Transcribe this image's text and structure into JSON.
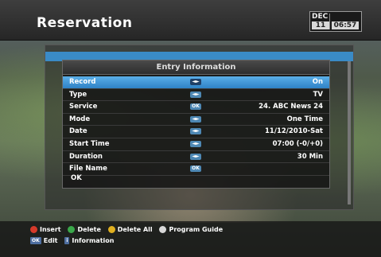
{
  "header": {
    "title": "Reservation",
    "clock": {
      "month": "DEC",
      "day": "11",
      "time": "06:57"
    }
  },
  "dialog": {
    "title": "Entry Information",
    "rows": [
      {
        "label": "Record",
        "icon": "arrows-icon",
        "value": "On",
        "selected": true
      },
      {
        "label": "Type",
        "icon": "arrows-icon",
        "value": "TV"
      },
      {
        "label": "Service",
        "icon": "ok-icon",
        "value": "24. ABC News 24"
      },
      {
        "label": "Mode",
        "icon": "arrows-icon",
        "value": "One Time"
      },
      {
        "label": "Date",
        "icon": "arrows-icon",
        "value": "11/12/2010-Sat"
      },
      {
        "label": "Start Time",
        "icon": "arrows-icon",
        "value": "07:00 (-0/+0)"
      },
      {
        "label": "Duration",
        "icon": "arrows-icon",
        "value": "30 Min"
      },
      {
        "label": "File Name",
        "icon": "ok-icon",
        "value": ""
      }
    ],
    "ok_label": "OK",
    "icon_text": {
      "arrows": "◄►",
      "ok": "OK"
    }
  },
  "legend": {
    "insert": "Insert",
    "delete": "Delete",
    "delete_all": "Delete All",
    "program_guide": "Program Guide",
    "edit": "Edit",
    "information": "Information",
    "ok_key": "OK",
    "info_key": "i",
    "colors": {
      "red": "#d63a2a",
      "green": "#3aa84a",
      "yellow": "#e0b020",
      "white": "#d8d8d8"
    }
  }
}
